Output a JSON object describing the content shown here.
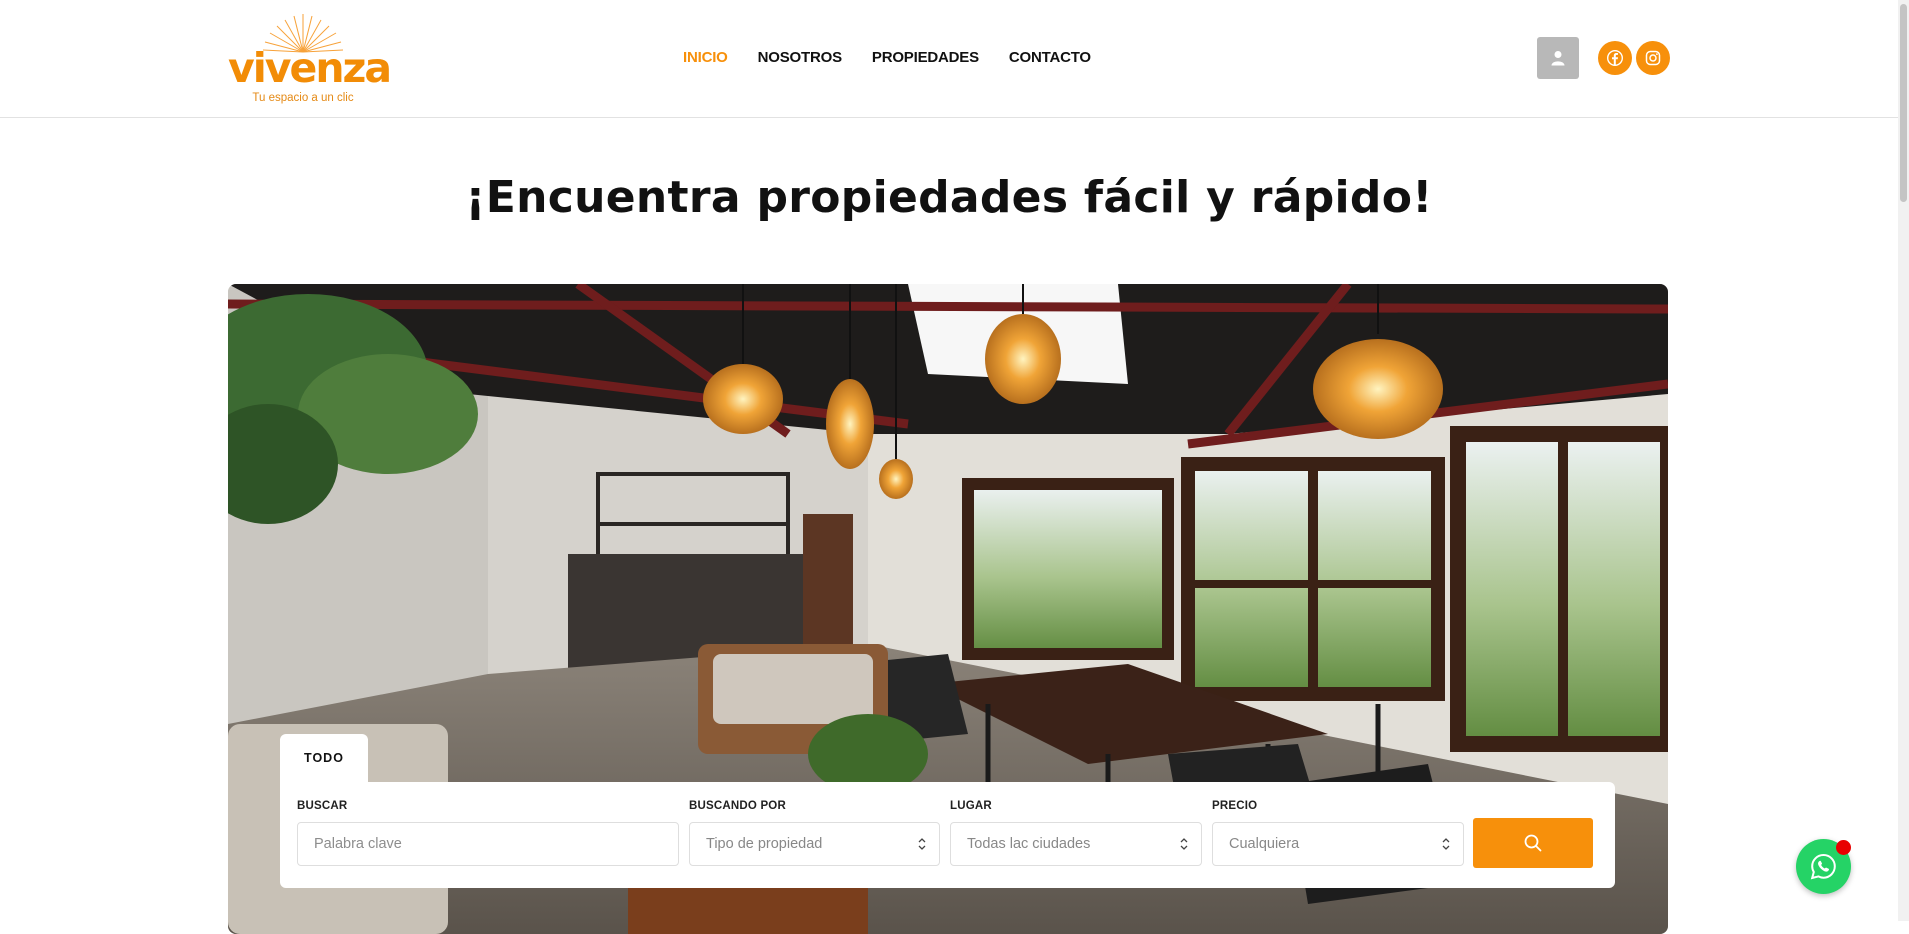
{
  "brand": {
    "name": "vivenza",
    "tagline": "Tu espacio a un clic",
    "accent": "#f7900b"
  },
  "nav": [
    {
      "label": "INICIO",
      "active": true
    },
    {
      "label": "NOSOTROS",
      "active": false
    },
    {
      "label": "PROPIEDADES",
      "active": false
    },
    {
      "label": "CONTACTO",
      "active": false
    }
  ],
  "header_icons": [
    "user-icon",
    "facebook-icon",
    "instagram-icon"
  ],
  "hero": {
    "title": "¡Encuentra propiedades fácil y rápido!"
  },
  "search": {
    "tab_label": "TODO",
    "fields": {
      "keyword": {
        "label": "BUSCAR",
        "placeholder": "Palabra clave",
        "value": ""
      },
      "type": {
        "label": "BUSCANDO POR",
        "value": "Tipo de propiedad"
      },
      "location": {
        "label": "LUGAR",
        "value": "Todas lac ciudades"
      },
      "price": {
        "label": "PRECIO",
        "value": "Cualquiera"
      }
    },
    "button_icon": "search-icon"
  },
  "floating": {
    "whatsapp_icon": "whatsapp-icon",
    "whatsapp_color": "#25d366",
    "notification_color": "#e80000"
  }
}
